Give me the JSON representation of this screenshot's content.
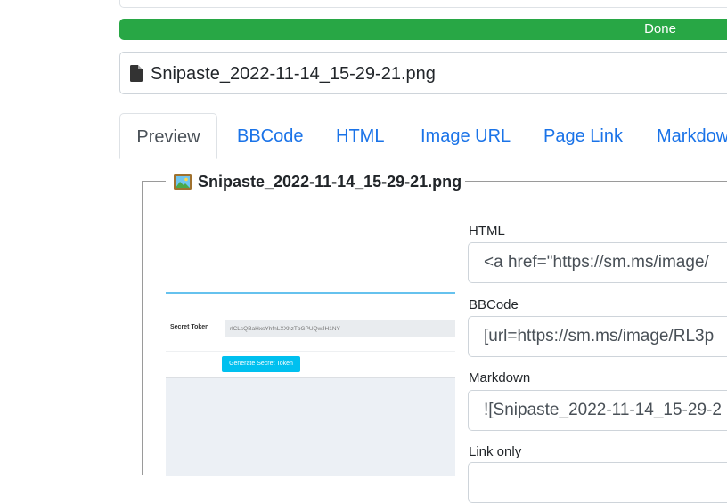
{
  "upload": {
    "progress_percent": 100,
    "progress_label": "Done",
    "file_icon": "file-icon",
    "file_name": "Snipaste_2022-11-14_15-29-21.png"
  },
  "tabs": [
    {
      "label": "Preview",
      "active": true
    },
    {
      "label": "BBCode",
      "active": false
    },
    {
      "label": "HTML",
      "active": false
    },
    {
      "label": "Image URL",
      "active": false
    },
    {
      "label": "Page Link",
      "active": false
    },
    {
      "label": "Markdow",
      "active": false
    }
  ],
  "result": {
    "legend_icon": "picture-icon",
    "legend_title": "Snipaste_2022-11-14_15-29-21.png",
    "preview": {
      "secret_token_label": "Secret Token",
      "secret_token_value": "rlCLsQBaHxsYhfnLXXhzTbGPUQwJH1NY",
      "generate_button_label": "Generate Secret Token"
    },
    "fields": [
      {
        "label": "HTML",
        "value": "<a href=\"https://sm.ms/image/"
      },
      {
        "label": "BBCode",
        "value": "[url=https://sm.ms/image/RL3p"
      },
      {
        "label": "Markdown",
        "value": "![Snipaste_2022-11-14_15-29-2"
      },
      {
        "label": "Link only",
        "value": ""
      }
    ]
  },
  "colors": {
    "progress_fill": "#28a745",
    "tab_link": "#1a73e8",
    "preview_button": "#00c0ef"
  }
}
